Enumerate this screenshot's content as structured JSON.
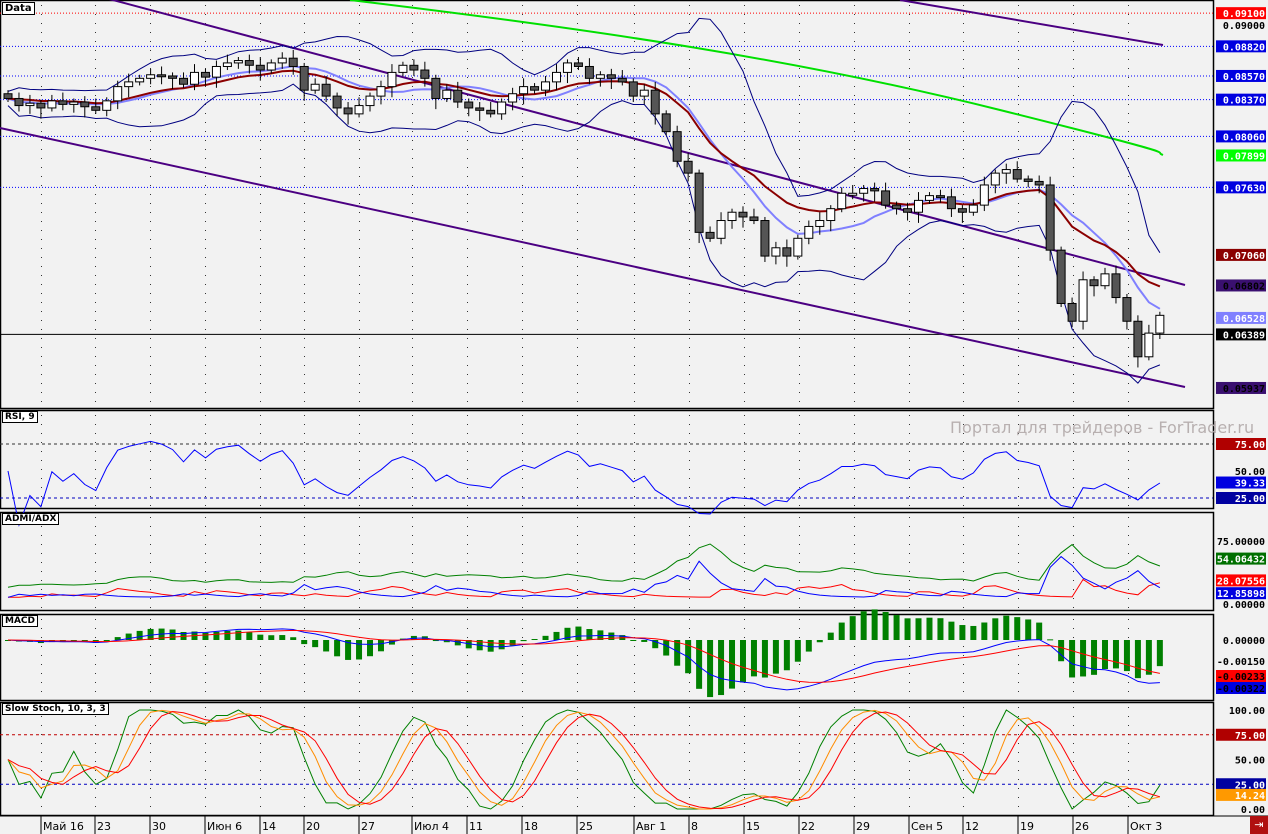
{
  "watermark": "Портал для трейдеров - ForTrader.ru",
  "colors": {
    "bg": "#f2f2f2",
    "up": "#ffffff",
    "down": "#555555",
    "ma_fast": "#8080ff",
    "ma_slow": "#8b0000",
    "bands": "#000080",
    "ma200": "#00e000",
    "channel": "#4b0082",
    "rsi": "#0000ff",
    "adx": "#008000",
    "dmi_plus": "#ff0000",
    "dmi_minus": "#0000ff",
    "macd_hist": "#008000",
    "stoch_k": "#008000",
    "stoch_d": "#ff0000",
    "stoch_s": "#ff8c00"
  },
  "chart_data": [
    {
      "type": "candlestick",
      "panel_title": "Data",
      "ylim": [
        0.0585,
        0.0915
      ],
      "closes": [
        0.0838,
        0.0832,
        0.0834,
        0.083,
        0.0836,
        0.0833,
        0.0835,
        0.0831,
        0.0828,
        0.0836,
        0.0848,
        0.0852,
        0.0855,
        0.0858,
        0.0857,
        0.0855,
        0.085,
        0.086,
        0.0856,
        0.0865,
        0.0868,
        0.087,
        0.0866,
        0.0862,
        0.0868,
        0.0872,
        0.0865,
        0.0845,
        0.085,
        0.084,
        0.083,
        0.0825,
        0.0832,
        0.084,
        0.0848,
        0.086,
        0.0866,
        0.0862,
        0.0855,
        0.0838,
        0.0845,
        0.0835,
        0.083,
        0.0828,
        0.0825,
        0.0835,
        0.0842,
        0.0848,
        0.0845,
        0.0852,
        0.086,
        0.0868,
        0.0865,
        0.0855,
        0.0858,
        0.0855,
        0.0852,
        0.084,
        0.0845,
        0.0825,
        0.081,
        0.0785,
        0.0775,
        0.0725,
        0.072,
        0.0735,
        0.0742,
        0.0738,
        0.0735,
        0.0705,
        0.0712,
        0.0705,
        0.072,
        0.073,
        0.0735,
        0.0745,
        0.0758,
        0.0758,
        0.0762,
        0.076,
        0.0748,
        0.0745,
        0.0742,
        0.0752,
        0.0756,
        0.0755,
        0.0745,
        0.0742,
        0.0748,
        0.0765,
        0.0775,
        0.0778,
        0.077,
        0.0768,
        0.0765,
        0.071,
        0.0665,
        0.065,
        0.0685,
        0.068,
        0.069,
        0.067,
        0.065,
        0.062,
        0.064,
        0.0655
      ],
      "levels": [
        {
          "value": 0.091,
          "text": "0.09100",
          "bg": "#ff0000",
          "fg": "#ffffff",
          "line": "#ff0000"
        },
        {
          "value": 0.09,
          "text": "0.09000",
          "bg": "",
          "fg": "#000000",
          "line": ""
        },
        {
          "value": 0.0882,
          "text": "0.08820",
          "bg": "#0000e0",
          "fg": "#ffffff",
          "line": "#0000ff"
        },
        {
          "value": 0.0857,
          "text": "0.08570",
          "bg": "#0000e0",
          "fg": "#ffffff",
          "line": "#0000ff"
        },
        {
          "value": 0.0837,
          "text": "0.08370",
          "bg": "#0000e0",
          "fg": "#ffffff",
          "line": "#0000ff"
        },
        {
          "value": 0.0806,
          "text": "0.08060",
          "bg": "#0000e0",
          "fg": "#ffffff",
          "line": "#0000ff"
        },
        {
          "value": 0.07899,
          "text": "0.07899",
          "bg": "#00ff00",
          "fg": "#ffffff",
          "line": ""
        },
        {
          "value": 0.0763,
          "text": "0.07630",
          "bg": "#0000e0",
          "fg": "#ffffff",
          "line": "#0000ff"
        },
        {
          "value": 0.0706,
          "text": "0.07060",
          "bg": "#8b0000",
          "fg": "#ffffff",
          "line": ""
        },
        {
          "value": 0.06802,
          "text": "0.06802",
          "bg": "#3a1070",
          "fg": "#000000",
          "line": ""
        },
        {
          "value": 0.06528,
          "text": "0.06528",
          "bg": "#8080ff",
          "fg": "#ffffff",
          "line": ""
        },
        {
          "value": 0.06389,
          "text": "0.06389",
          "bg": "#000000",
          "fg": "#ffffff",
          "line": "#000000"
        },
        {
          "value": 0.05937,
          "text": "0.05937",
          "bg": "#3a1070",
          "fg": "#000000",
          "line": ""
        }
      ]
    },
    {
      "type": "line",
      "panel_title": "RSI, 9",
      "ylim": [
        0,
        100
      ],
      "ticks": [
        "50.00"
      ],
      "labels": [
        {
          "text": "75.00",
          "value": 75,
          "bg": "#b00000"
        },
        {
          "text": "39.33",
          "value": 39.33,
          "bg": "#0000e0"
        },
        {
          "text": "25.00",
          "value": 25,
          "bg": "#0000a0"
        }
      ]
    },
    {
      "type": "line",
      "panel_title": "ADMI/ADX",
      "ylim": [
        0,
        100
      ],
      "ticks": [
        "75.00000",
        "0.00000"
      ],
      "labels": [
        {
          "text": "54.06432",
          "value": 54.06,
          "bg": "#007000"
        },
        {
          "text": "28.07556",
          "value": 28.08,
          "bg": "#ff0000"
        },
        {
          "text": "12.85898",
          "value": 12.86,
          "bg": "#0000e0"
        }
      ]
    },
    {
      "type": "line",
      "panel_title": "MACD",
      "ticks": [
        "0.00000",
        "-0.00150"
      ],
      "labels": [
        {
          "text": "-0.00233",
          "value": -0.00233,
          "bg": "#ff0000"
        },
        {
          "text": "-0.00322",
          "value": -0.00322,
          "bg": "#0000e0"
        }
      ]
    },
    {
      "type": "line",
      "panel_title": "Slow Stoch, 10, 3, 3",
      "ylim": [
        0,
        100
      ],
      "ticks": [
        "100.00",
        "50.00",
        "0.00"
      ],
      "labels": [
        {
          "text": "75.00",
          "value": 75,
          "bg": "#b00000"
        },
        {
          "text": "25.00",
          "value": 25,
          "bg": "#0000a0"
        },
        {
          "text": "14.24",
          "value": 14.24,
          "bg": "#ff9900"
        }
      ]
    }
  ],
  "x_axis": [
    "Май 16",
    "23",
    "30",
    "Июн 6",
    "14",
    "20",
    "27",
    "Июл 4",
    "11",
    "18",
    "25",
    "Авг 1",
    "8",
    "15",
    "22",
    "29",
    "Сен 5",
    "12",
    "19",
    "26",
    "Окт 3"
  ]
}
